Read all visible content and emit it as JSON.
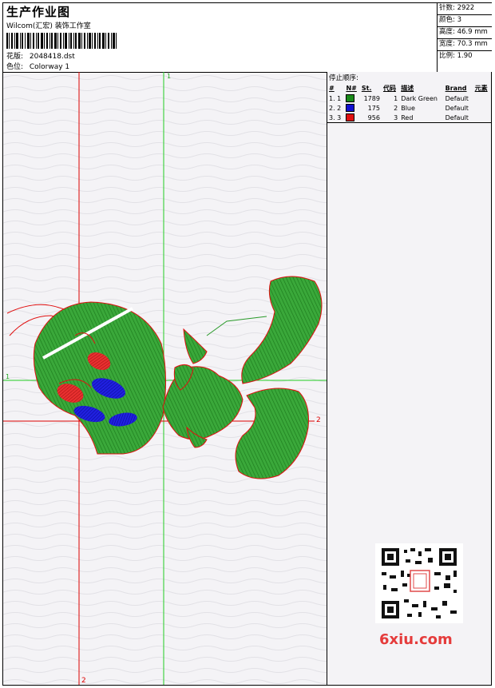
{
  "header": {
    "title": "生产作业图",
    "subtitle": "Wilcom(汇宏) 装饰工作室",
    "design_label": "花版:",
    "design_value": "2048418.dst",
    "colorway_label": "色位:",
    "colorway_value": "Colorway 1"
  },
  "stats": [
    {
      "label": "针数:",
      "value": "2922"
    },
    {
      "label": "颜色:",
      "value": "3"
    },
    {
      "label": "高度:",
      "value": "46.9 mm"
    },
    {
      "label": "宽度:",
      "value": "70.3 mm"
    },
    {
      "label": "比例:",
      "value": "1.90"
    }
  ],
  "axes": {
    "green_vertical": "1",
    "green_horizontal": "1",
    "red_vertical": "2",
    "red_horizontal": "2"
  },
  "stop_sequence": {
    "title": "停止顺序:",
    "columns": [
      "#",
      "N#",
      "St.",
      "代码",
      "描述",
      "Brand",
      "元素"
    ],
    "rows": [
      {
        "idx": "1. 1",
        "color": "#1a8a1a",
        "st": "1789",
        "code": "1",
        "desc": "Dark Green",
        "brand": "Default"
      },
      {
        "idx": "2. 2",
        "color": "#1010d0",
        "st": "175",
        "code": "2",
        "desc": "Blue",
        "brand": "Default"
      },
      {
        "idx": "3. 3",
        "color": "#e01010",
        "st": "956",
        "code": "3",
        "desc": "Red",
        "brand": "Default"
      }
    ]
  },
  "watermark": {
    "text": "6xiu.com"
  },
  "colors": {
    "green": "#2a9a2a",
    "red": "#e01010",
    "blue": "#1010d0",
    "guide_green": "#22cc22",
    "guide_red": "#dd0000"
  }
}
